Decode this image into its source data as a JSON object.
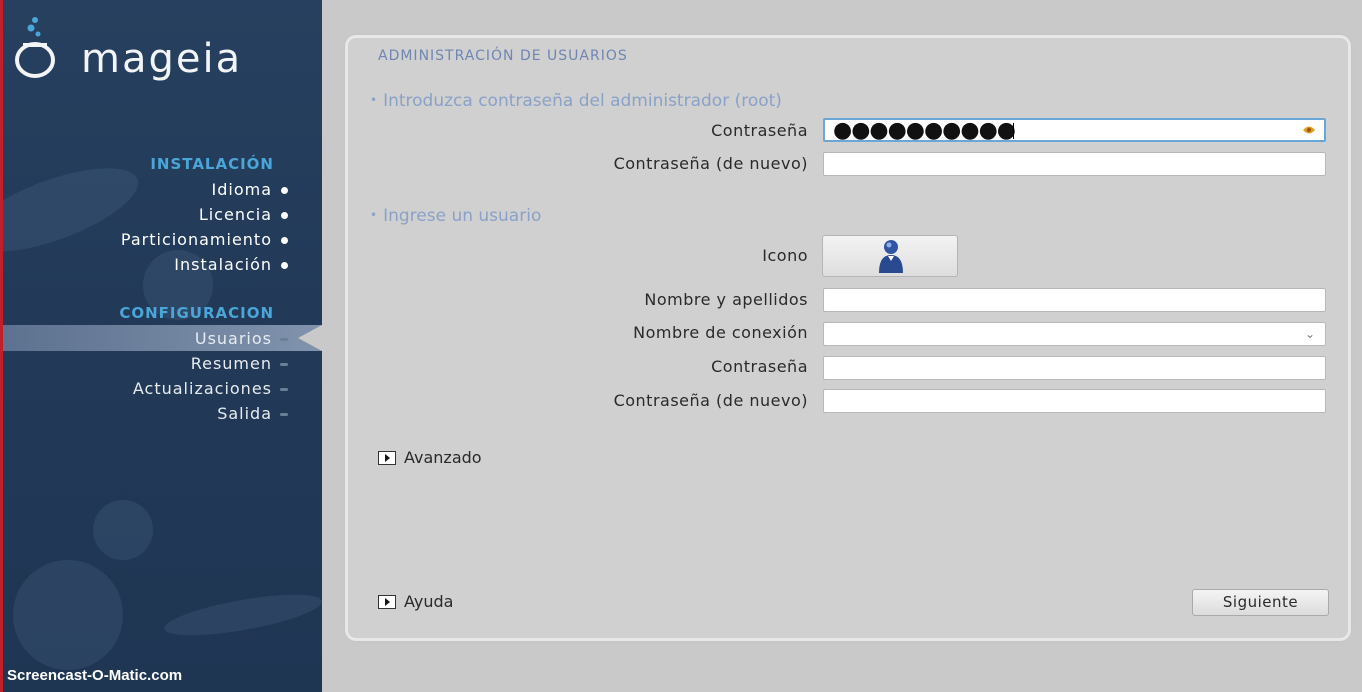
{
  "brand": {
    "name": "mageia"
  },
  "sidebar": {
    "sections": [
      {
        "title": "INSTALACIÓN",
        "items": [
          {
            "label": "Idioma"
          },
          {
            "label": "Licencia"
          },
          {
            "label": "Particionamiento"
          },
          {
            "label": "Instalación"
          }
        ]
      },
      {
        "title": "CONFIGURACION",
        "items": [
          {
            "label": "Usuarios"
          },
          {
            "label": "Resumen"
          },
          {
            "label": "Actualizaciones"
          },
          {
            "label": "Salida"
          }
        ]
      }
    ]
  },
  "watermark": "Screencast-O-Matic.com",
  "panel": {
    "title": "ADMINISTRACIÓN DE USUARIOS",
    "root_section": {
      "heading": "Introduzca contraseña del administrador (root)",
      "password_label": "Contraseña",
      "password_value": "●●●●●●●●●●",
      "password_repeat_label": "Contraseña (de nuevo)",
      "password_repeat_value": ""
    },
    "user_section": {
      "heading": "Ingrese un usuario",
      "icon_label": "Icono",
      "fullname_label": "Nombre y apellidos",
      "fullname_value": "",
      "login_label": "Nombre de conexión",
      "login_value": "",
      "password_label": "Contraseña",
      "password_value": "",
      "password_repeat_label": "Contraseña (de nuevo)",
      "password_repeat_value": ""
    },
    "advanced_label": "Avanzado",
    "help_label": "Ayuda",
    "next_label": "Siguiente"
  },
  "colors": {
    "sidebar_bg": "#223a58",
    "section_title": "#4aa6d8",
    "panel_bg": "#d0d0d0",
    "heading": "#8aa1c8",
    "focus": "#6aa6d6"
  },
  "icons": {
    "logo": "mageia-cauldron-icon",
    "password_key": "key-icon",
    "user_avatar": "user-icon",
    "dropdown": "chevron-down-icon",
    "expander": "triangle-right-icon"
  }
}
